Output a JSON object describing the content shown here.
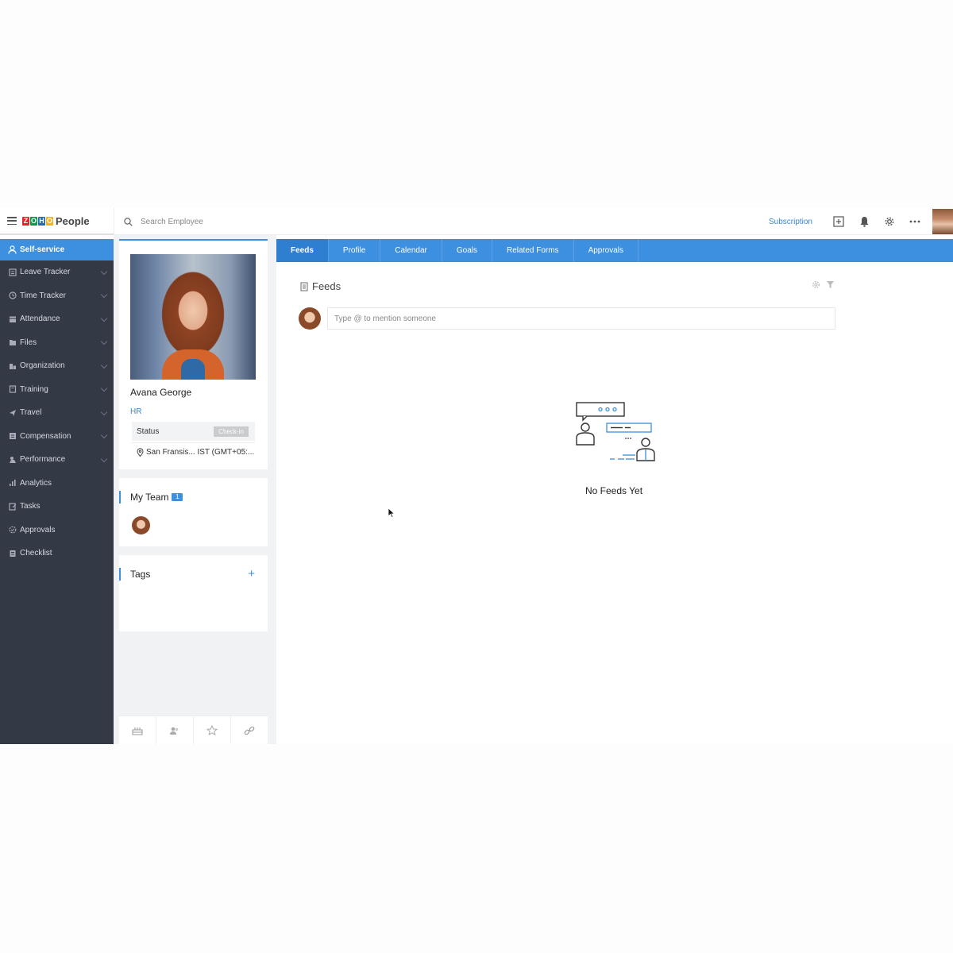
{
  "brand": {
    "name": "People",
    "zoho_letters": [
      "Z",
      "O",
      "H",
      "O"
    ],
    "zoho_colors": [
      "#e42527",
      "#089949",
      "#226db4",
      "#f9b21d"
    ]
  },
  "search": {
    "placeholder": "Search Employee"
  },
  "topbar": {
    "subscription_label": "Subscription"
  },
  "sidebar": {
    "items": [
      {
        "label": "Self-service",
        "icon": "user-icon",
        "active": true
      },
      {
        "label": "Leave Tracker",
        "icon": "leave-icon"
      },
      {
        "label": "Time Tracker",
        "icon": "clock-icon"
      },
      {
        "label": "Attendance",
        "icon": "calendar-grid-icon"
      },
      {
        "label": "Files",
        "icon": "folder-icon"
      },
      {
        "label": "Organization",
        "icon": "building-icon"
      },
      {
        "label": "Training",
        "icon": "book-icon"
      },
      {
        "label": "Travel",
        "icon": "plane-icon"
      },
      {
        "label": "Compensation",
        "icon": "money-icon"
      },
      {
        "label": "Performance",
        "icon": "performance-icon"
      },
      {
        "label": "Analytics",
        "icon": "bar-chart-icon"
      },
      {
        "label": "Tasks",
        "icon": "tasks-icon"
      },
      {
        "label": "Approvals",
        "icon": "approvals-icon"
      },
      {
        "label": "Checklist",
        "icon": "checklist-icon"
      }
    ]
  },
  "profile": {
    "name": "Avana George",
    "department": "HR",
    "status_label": "Status",
    "checkin_label": "Check-in",
    "location": "San Fransis... IST (GMT+05:..."
  },
  "team": {
    "title": "My Team",
    "count": "1"
  },
  "tags": {
    "title": "Tags",
    "add_label": "+"
  },
  "tabs": [
    "Feeds",
    "Profile",
    "Calendar",
    "Goals",
    "Related Forms",
    "Approvals"
  ],
  "feeds": {
    "title": "Feeds",
    "input_placeholder": "Type @ to mention someone",
    "empty_text": "No Feeds Yet"
  },
  "colors": {
    "accent": "#3d8fe0",
    "sidebar_bg": "#333a45",
    "link": "#3a86d4"
  }
}
